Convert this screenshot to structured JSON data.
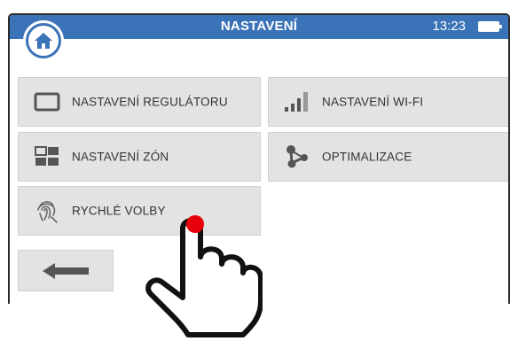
{
  "header": {
    "title": "NASTAVENÍ",
    "time": "13:23",
    "battery_icon": "battery-icon",
    "home_icon": "home-icon",
    "accent_color": "#3b73b8"
  },
  "menu": {
    "items": [
      {
        "label": "NASTAVENÍ REGULÁTORU",
        "icon": "display-icon"
      },
      {
        "label": "NASTAVENÍ WI-FI",
        "icon": "signal-bars-icon"
      },
      {
        "label": "NASTAVENÍ ZÓN",
        "icon": "zones-grid-icon"
      },
      {
        "label": "OPTIMALIZACE",
        "icon": "nodes-icon"
      },
      {
        "label": "RYCHLÉ VOLBY",
        "icon": "fingerprint-icon"
      }
    ]
  },
  "footer": {
    "back_icon": "arrow-left-icon"
  },
  "overlay": {
    "pointer_icon": "hand-pointer-icon",
    "tap_indicator_color": "#e8000b"
  }
}
